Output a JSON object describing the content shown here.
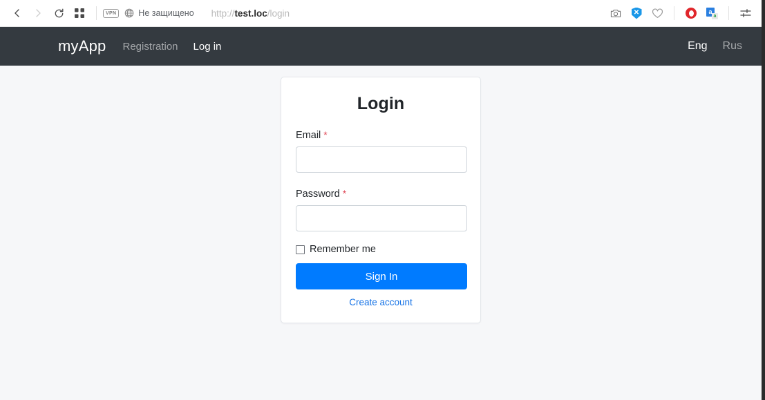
{
  "browser": {
    "back_icon": "chevron-left-icon",
    "forward_icon": "chevron-right-icon",
    "reload_icon": "reload-icon",
    "speeddial_icon": "grid-squares-icon",
    "vpn_label": "VPN",
    "security_label": "Не защищено",
    "url": {
      "scheme": "http://",
      "host": "test.loc",
      "path": "/login"
    },
    "extensions": [
      {
        "name": "snapshot-icon",
        "label": ""
      },
      {
        "name": "shield-block-icon",
        "label": "✕"
      },
      {
        "name": "heart-icon",
        "label": ""
      },
      {
        "name": "ad-blocker-icon",
        "label": ""
      },
      {
        "name": "translate-icon",
        "label": "a",
        "sub_label": "а"
      },
      {
        "name": "easy-setup-icon",
        "label": ""
      }
    ]
  },
  "navbar": {
    "brand": "myApp",
    "links": [
      {
        "label": "Registration",
        "active": false
      },
      {
        "label": "Log in",
        "active": true
      }
    ],
    "languages": [
      {
        "label": "Eng",
        "active": true
      },
      {
        "label": "Rus",
        "active": false
      }
    ]
  },
  "login_card": {
    "title": "Login",
    "email": {
      "label": "Email",
      "required_mark": "*",
      "value": "",
      "placeholder": ""
    },
    "password": {
      "label": "Password",
      "required_mark": "*",
      "value": "",
      "placeholder": ""
    },
    "remember": {
      "label": "Remember me",
      "checked": false
    },
    "submit_label": "Sign In",
    "create_account_label": "Create account"
  },
  "colors": {
    "primary": "#007bff",
    "navbar_bg": "#343a40",
    "page_bg": "#f6f7f9",
    "link": "#1673e6",
    "required": "#e04b59"
  }
}
